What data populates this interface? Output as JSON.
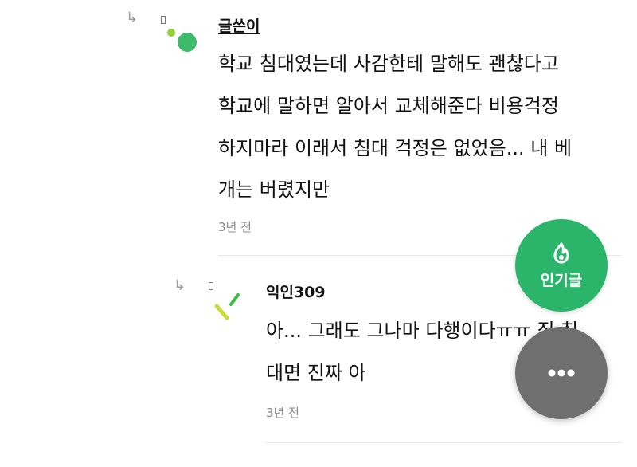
{
  "comments": [
    {
      "author": "글쓴이",
      "lines": [
        "학교 침대였는데 사감한테 말해도 괜찮다고",
        "학교에 말하면 알아서 교체해준다 비용걱정",
        "하지마라 이래서 침대 걱정은 없었음... 내 베",
        "개는 버렸지만"
      ],
      "time": "3년 전"
    },
    {
      "author": "익인309",
      "lines": [
        "아... 그래도 그나마 다행이다ㅠㅠ 집 침",
        "대면 진짜 아"
      ],
      "time": "3년 전"
    }
  ],
  "fab": {
    "hot_label": "인기글",
    "more_icon": "more-dots-icon",
    "hot_icon": "flame-icon"
  },
  "colors": {
    "green": "#2bb56a",
    "gray_fab": "#6f6f6f"
  }
}
